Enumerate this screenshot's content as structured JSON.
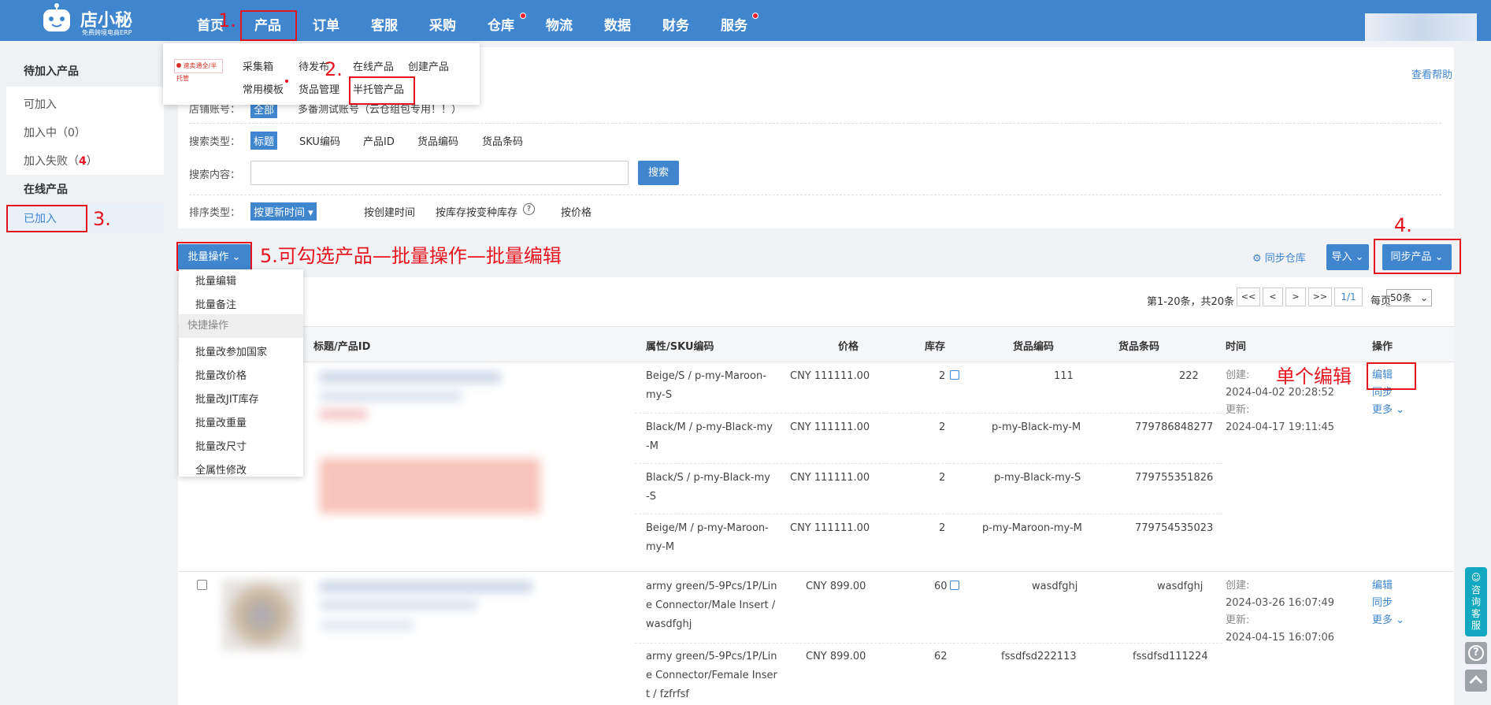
{
  "nav": {
    "logo_text": "店小秘",
    "logo_sub": "免费跨境电商ERP",
    "items": [
      "首页",
      "产品",
      "订单",
      "客服",
      "采购",
      "仓库",
      "物流",
      "数据",
      "财务",
      "服务"
    ]
  },
  "annotations": {
    "a1": "1.",
    "a2": "2.",
    "a3": "3.",
    "a4": "4.",
    "a5": "5.可勾选产品—批量操作—批量编辑",
    "single": "单个编辑"
  },
  "product_menu": {
    "badge": "速卖通全/半托管",
    "row1": [
      "采集箱",
      "待发布",
      "在线产品",
      "创建产品"
    ],
    "row2": [
      "常用模板",
      "货品管理",
      "半托管产品"
    ]
  },
  "sidebar": {
    "section1": "待加入产品",
    "items1": [
      "可加入",
      "加入中（0）",
      "加入失败（"
    ],
    "fail_count": "4",
    "fail_close": "）",
    "section2": "在线产品",
    "active": "已加入"
  },
  "help": "查看帮助",
  "filters": {
    "shop_label": "店铺账号：",
    "shop_all": "全部",
    "shop_name": "多番测试账号（云仓组包专用！！）",
    "search_type_label": "搜索类型：",
    "search_types": [
      "标题",
      "SKU编码",
      "产品ID",
      "货品编码",
      "货品条码"
    ],
    "search_content_label": "搜索内容：",
    "search_btn": "搜索",
    "sort_label": "排序类型：",
    "sorts": [
      "按更新时间",
      "按创建时间",
      "按库存",
      "按变种库存",
      "按价格"
    ]
  },
  "toolbar": {
    "batch": "批量操作",
    "sync_wh": "同步仓库",
    "import": "导入",
    "sync_products": "同步产品"
  },
  "batch_menu": {
    "items_top": [
      "批量编辑",
      "批量备注"
    ],
    "quick": "快捷操作",
    "items": [
      "批量改参加国家",
      "批量改价格",
      "批量改JIT库存",
      "批量改重量",
      "批量改尺寸",
      "全属性修改"
    ]
  },
  "pager": {
    "range": "第1-20条，共20条",
    "first": "<<",
    "prev": "<",
    "next": ">",
    "last": ">>",
    "page": "1/1",
    "per_page": "每页",
    "size": "50条"
  },
  "table": {
    "headers": [
      "标题/产品ID",
      "属性/SKU编码",
      "价格",
      "库存",
      "货品编码",
      "货品条码",
      "时间",
      "操作"
    ],
    "products": [
      {
        "created_label": "创建:",
        "created": "2024-04-02 20:28:52",
        "updated_label": "更新:",
        "updated": "2024-04-17 19:11:45",
        "actions": [
          "编辑",
          "同步",
          "更多"
        ],
        "skus": [
          {
            "attr1": "Beige/S  /  p-my-Maroon-",
            "attr2": "my-S",
            "price": "CNY 111111.00",
            "stock": "2",
            "code": "111",
            "barcode": "222"
          },
          {
            "attr1": "Black/M  /  p-my-Black-my",
            "attr2": "-M",
            "price": "CNY 111111.00",
            "stock": "2",
            "code": "p-my-Black-my-M",
            "barcode": "779786848277"
          },
          {
            "attr1": "Black/S  /  p-my-Black-my",
            "attr2": "-S",
            "price": "CNY 111111.00",
            "stock": "2",
            "code": "p-my-Black-my-S",
            "barcode": "779755351826"
          },
          {
            "attr1": "Beige/M  /  p-my-Maroon-",
            "attr2": "my-M",
            "price": "CNY 111111.00",
            "stock": "2",
            "code": "p-my-Maroon-my-M",
            "barcode": "779754535023"
          }
        ]
      },
      {
        "created_label": "创建:",
        "created": "2024-03-26 16:07:49",
        "updated_label": "更新:",
        "updated": "2024-04-15 16:07:06",
        "actions": [
          "编辑",
          "同步",
          "更多"
        ],
        "skus": [
          {
            "attr1": "army green/5-9Pcs/1P/Lin",
            "attr2": "e Connector/Male Insert  /",
            "attr3": " wasdfghj",
            "price": "CNY 899.00",
            "stock": "60",
            "code": "wasdfghj",
            "barcode": "wasdfghj"
          },
          {
            "attr1": "army green/5-9Pcs/1P/Lin",
            "attr2": "e Connector/Female Inser",
            "attr3": "t  /  fzfrfsf",
            "price": "CNY 899.00",
            "stock": "62",
            "code": "fssdfsd222113",
            "barcode": "fssdfsd111224"
          }
        ]
      }
    ]
  },
  "float": {
    "consult": "咨询客服",
    "help_icon": "?"
  },
  "colors": {
    "primary": "#3f86cf",
    "annotation": "#e5141e"
  }
}
